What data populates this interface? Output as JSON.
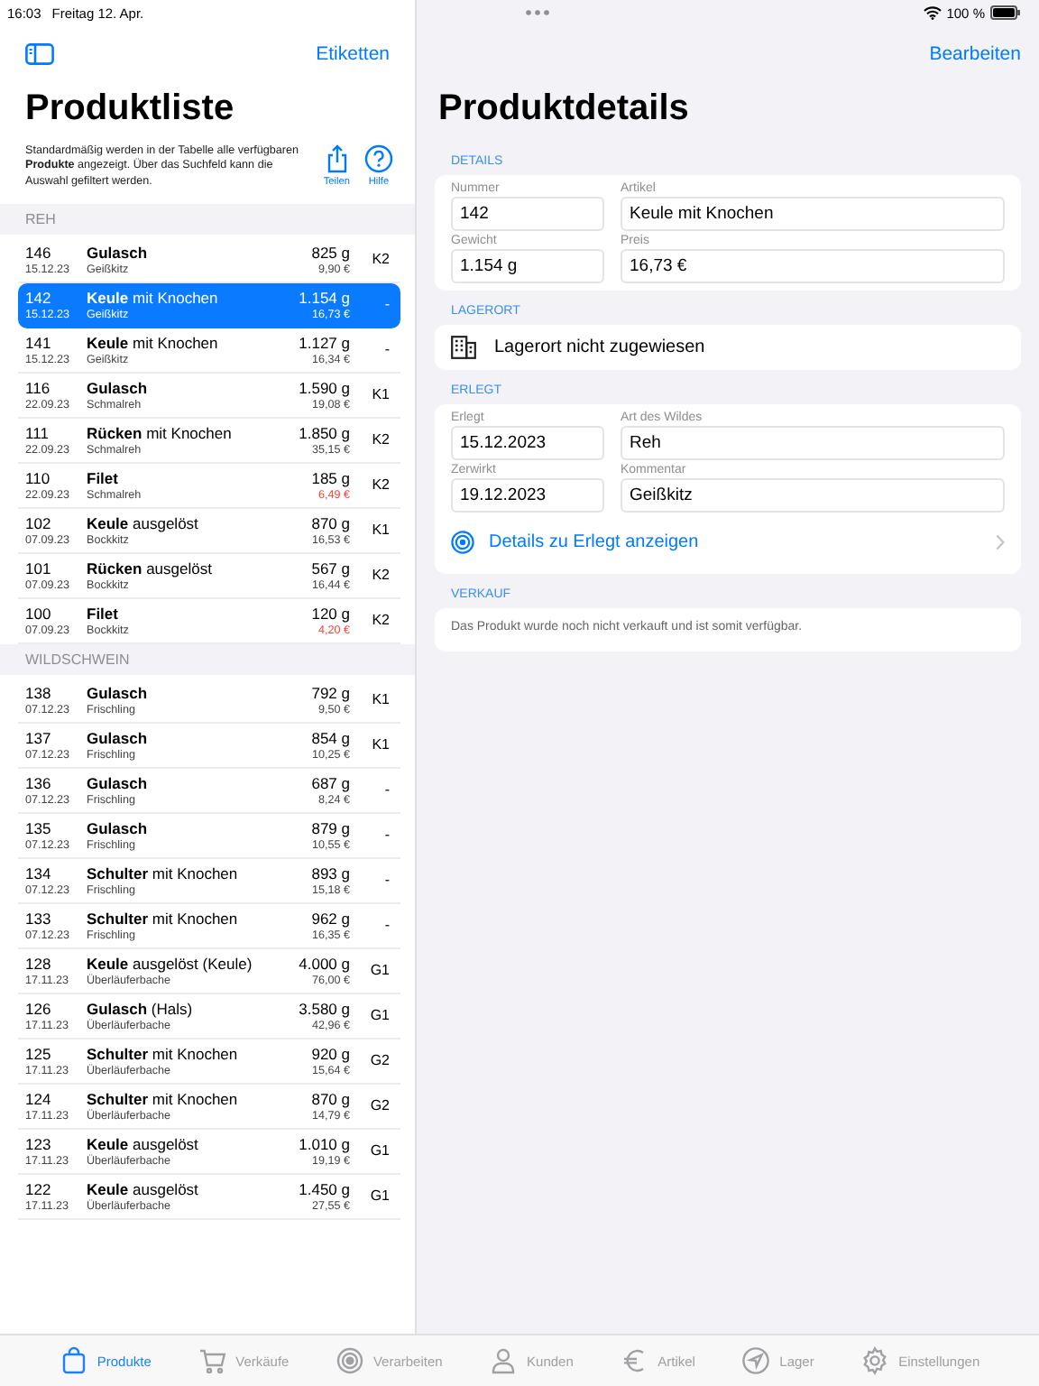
{
  "status_bar": {
    "time": "16:03",
    "date": "Freitag 12. Apr.",
    "battery": "100 %"
  },
  "list_pane": {
    "toolbar_button": "Etiketten",
    "title": "Produktliste",
    "description": "Standardmäßig werden in der Tabelle alle verfügbaren **Produkte** angezeigt. Über das Suchfeld kann die Auswahl gefiltert werden.",
    "actions": [
      {
        "kind": "share",
        "label": "Teilen"
      },
      {
        "kind": "help",
        "label": "Hilfe"
      }
    ],
    "sections": [
      {
        "title": "REH",
        "rows": [
          {
            "number": "146",
            "date": "15.12.23",
            "name": "**Gulasch**",
            "sub": "Geißkitz",
            "weight": "825 g",
            "price": "9,90 €",
            "price_low": false,
            "grade": "K2",
            "selected": false
          },
          {
            "number": "142",
            "date": "15.12.23",
            "name": "**Keule** mit Knochen",
            "sub": "Geißkitz",
            "weight": "1.154 g",
            "price": "16,73 €",
            "price_low": false,
            "grade": "-",
            "selected": true
          },
          {
            "number": "141",
            "date": "15.12.23",
            "name": "**Keule** mit Knochen",
            "sub": "Geißkitz",
            "weight": "1.127 g",
            "price": "16,34 €",
            "price_low": false,
            "grade": "-",
            "selected": false
          },
          {
            "number": "116",
            "date": "22.09.23",
            "name": "**Gulasch**",
            "sub": "Schmalreh",
            "weight": "1.590 g",
            "price": "19,08 €",
            "price_low": false,
            "grade": "K1",
            "selected": false
          },
          {
            "number": "111",
            "date": "22.09.23",
            "name": "**Rücken** mit Knochen",
            "sub": "Schmalreh",
            "weight": "1.850 g",
            "price": "35,15 €",
            "price_low": false,
            "grade": "K2",
            "selected": false
          },
          {
            "number": "110",
            "date": "22.09.23",
            "name": "**Filet**",
            "sub": "Schmalreh",
            "weight": "185 g",
            "price": "6,49 €",
            "price_low": true,
            "grade": "K2",
            "selected": false
          },
          {
            "number": "102",
            "date": "07.09.23",
            "name": "**Keule** ausgelöst",
            "sub": "Bockkitz",
            "weight": "870 g",
            "price": "16,53 €",
            "price_low": false,
            "grade": "K1",
            "selected": false
          },
          {
            "number": "101",
            "date": "07.09.23",
            "name": "**Rücken** ausgelöst",
            "sub": "Bockkitz",
            "weight": "567 g",
            "price": "16,44 €",
            "price_low": false,
            "grade": "K2",
            "selected": false
          },
          {
            "number": "100",
            "date": "07.09.23",
            "name": "**Filet**",
            "sub": "Bockkitz",
            "weight": "120 g",
            "price": "4,20 €",
            "price_low": true,
            "grade": "K2",
            "selected": false
          }
        ]
      },
      {
        "title": "WILDSCHWEIN",
        "rows": [
          {
            "number": "138",
            "date": "07.12.23",
            "name": "**Gulasch**",
            "sub": "Frischling",
            "weight": "792 g",
            "price": "9,50 €",
            "price_low": false,
            "grade": "K1",
            "selected": false
          },
          {
            "number": "137",
            "date": "07.12.23",
            "name": "**Gulasch**",
            "sub": "Frischling",
            "weight": "854 g",
            "price": "10,25 €",
            "price_low": false,
            "grade": "K1",
            "selected": false
          },
          {
            "number": "136",
            "date": "07.12.23",
            "name": "**Gulasch**",
            "sub": "Frischling",
            "weight": "687 g",
            "price": "8,24 €",
            "price_low": false,
            "grade": "-",
            "selected": false
          },
          {
            "number": "135",
            "date": "07.12.23",
            "name": "**Gulasch**",
            "sub": "Frischling",
            "weight": "879 g",
            "price": "10,55 €",
            "price_low": false,
            "grade": "-",
            "selected": false
          },
          {
            "number": "134",
            "date": "07.12.23",
            "name": "**Schulter** mit Knochen",
            "sub": "Frischling",
            "weight": "893 g",
            "price": "15,18 €",
            "price_low": false,
            "grade": "-",
            "selected": false
          },
          {
            "number": "133",
            "date": "07.12.23",
            "name": "**Schulter** mit Knochen",
            "sub": "Frischling",
            "weight": "962 g",
            "price": "16,35 €",
            "price_low": false,
            "grade": "-",
            "selected": false
          },
          {
            "number": "128",
            "date": "17.11.23",
            "name": "**Keule** ausgelöst (Keule)",
            "sub": "Überläuferbache",
            "weight": "4.000 g",
            "price": "76,00 €",
            "price_low": false,
            "grade": "G1",
            "selected": false
          },
          {
            "number": "126",
            "date": "17.11.23",
            "name": "**Gulasch** (Hals)",
            "sub": "Überläuferbache",
            "weight": "3.580 g",
            "price": "42,96 €",
            "price_low": false,
            "grade": "G1",
            "selected": false
          },
          {
            "number": "125",
            "date": "17.11.23",
            "name": "**Schulter** mit Knochen",
            "sub": "Überläuferbache",
            "weight": "920 g",
            "price": "15,64 €",
            "price_low": false,
            "grade": "G2",
            "selected": false
          },
          {
            "number": "124",
            "date": "17.11.23",
            "name": "**Schulter** mit Knochen",
            "sub": "Überläuferbache",
            "weight": "870 g",
            "price": "14,79 €",
            "price_low": false,
            "grade": "G2",
            "selected": false
          },
          {
            "number": "123",
            "date": "17.11.23",
            "name": "**Keule** ausgelöst",
            "sub": "Überläuferbache",
            "weight": "1.010 g",
            "price": "19,19 €",
            "price_low": false,
            "grade": "G1",
            "selected": false
          },
          {
            "number": "122",
            "date": "17.11.23",
            "name": "**Keule** ausgelöst",
            "sub": "Überläuferbache",
            "weight": "1.450 g",
            "price": "27,55 €",
            "price_low": false,
            "grade": "G1",
            "selected": false
          }
        ]
      }
    ]
  },
  "detail_pane": {
    "edit_button": "Bearbeiten",
    "title": "Produktdetails",
    "groups": [
      {
        "kind": "fields",
        "title": "DETAILS",
        "fields": [
          {
            "label": "Nummer",
            "value": "142"
          },
          {
            "label": "Artikel",
            "value": "Keule mit Knochen"
          },
          {
            "label": "Gewicht",
            "value": "1.154 g"
          },
          {
            "label": "Preis",
            "value": "16,73 €"
          }
        ]
      },
      {
        "kind": "location",
        "title": "LAGERORT",
        "text": "Lagerort nicht zugewiesen"
      },
      {
        "kind": "fields",
        "title": "ERLEGT",
        "fields": [
          {
            "label": "Erlegt",
            "value": "15.12.2023"
          },
          {
            "label": "Art des Wildes",
            "value": "Reh"
          },
          {
            "label": "Zerwirkt",
            "value": "19.12.2023"
          },
          {
            "label": "Kommentar",
            "value": "Geißkitz"
          }
        ],
        "link": "Details zu Erlegt anzeigen"
      },
      {
        "kind": "note",
        "title": "VERKAUF",
        "text": "Das Produkt wurde noch nicht verkauft und ist somit verfügbar."
      }
    ]
  },
  "tab_bar": [
    {
      "kind": "bag",
      "label": "Produkte",
      "selected": true
    },
    {
      "kind": "cart",
      "label": "Verkäufe",
      "selected": false
    },
    {
      "kind": "target",
      "label": "Verarbeiten",
      "selected": false
    },
    {
      "kind": "person",
      "label": "Kunden",
      "selected": false
    },
    {
      "kind": "euro",
      "label": "Artikel",
      "selected": false
    },
    {
      "kind": "location",
      "label": "Lager",
      "selected": false
    },
    {
      "kind": "gear",
      "label": "Einstellungen",
      "selected": false
    }
  ]
}
